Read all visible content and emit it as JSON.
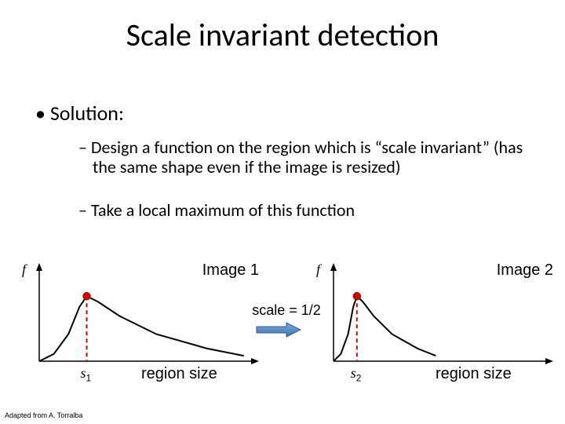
{
  "title": "Scale invariant detection",
  "bullets": {
    "solution": "Solution:",
    "sub1": "Design a function on the region which is “scale invariant” (has the same shape even if the image is resized)",
    "sub2": "Take a local maximum of this function"
  },
  "scale_note": "scale = 1/2",
  "attribution": "Adapted from A. Torralba",
  "chart_data": [
    {
      "type": "line",
      "title": "Image 1",
      "ylabel": "f",
      "xlabel": "region size",
      "marker_label": "s1",
      "marker_x": 65,
      "x": [
        0,
        20,
        40,
        55,
        65,
        80,
        110,
        160,
        230,
        280
      ],
      "y": [
        0,
        8,
        30,
        60,
        72,
        66,
        50,
        30,
        14,
        6
      ],
      "xlim": [
        0,
        290
      ],
      "ylim": [
        0,
        100
      ]
    },
    {
      "type": "line",
      "title": "Image 2",
      "ylabel": "f",
      "xlabel": "region size",
      "marker_label": "s2",
      "marker_x": 32,
      "x": [
        0,
        10,
        20,
        27,
        32,
        40,
        55,
        80,
        115,
        140
      ],
      "y": [
        0,
        8,
        30,
        60,
        72,
        66,
        50,
        30,
        14,
        6
      ],
      "xlim": [
        0,
        290
      ],
      "ylim": [
        0,
        100
      ]
    }
  ]
}
